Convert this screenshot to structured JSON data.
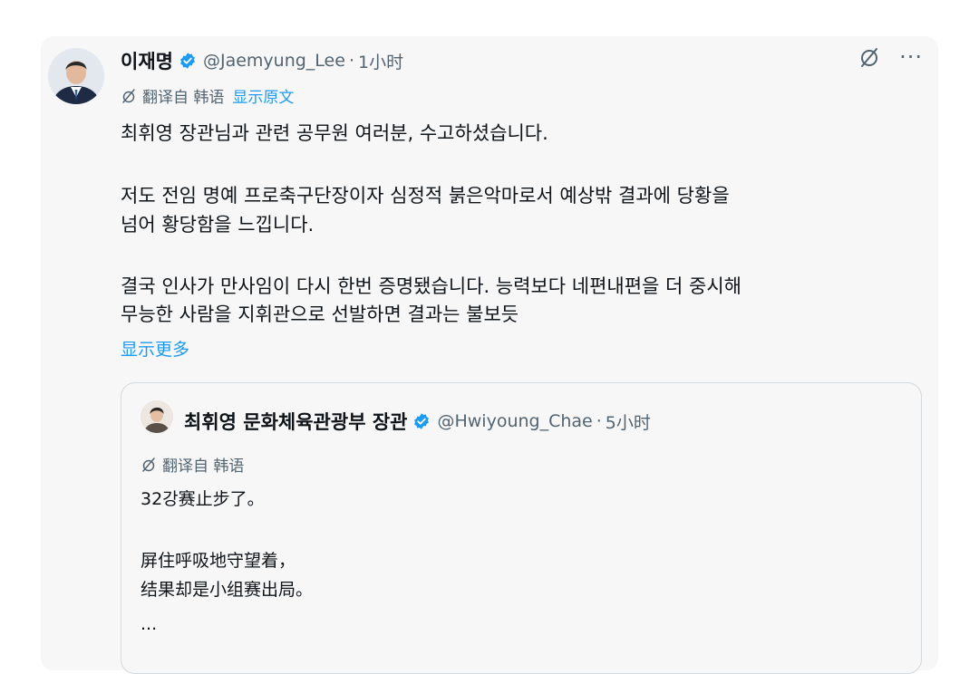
{
  "tweet": {
    "author_name": "이재명",
    "handle": "@Jaemyung_Lee",
    "separator": "·",
    "time": "1小时",
    "translated_from": "翻译自 韩语",
    "show_original": "显示原文",
    "paragraphs": [
      [
        "최휘영 장관님과 관련 공무원 여러분, 수고하셨습니다."
      ],
      [
        "저도 전임 명예 프로축구단장이자 심정적 붉은악마로서 예상밖 결과에 당황을",
        "넘어 황당함을 느낍니다."
      ],
      [
        "결국 인사가 만사임이 다시 한번 증명됐습니다. 능력보다 네편내편을 더 중시해",
        "무능한 사람을 지휘관으로 선발하면 결과는 불보듯"
      ]
    ],
    "show_more": "显示更多",
    "more_glyph": "···"
  },
  "quoted": {
    "author_name": "최휘영 문화체육관광부 장관",
    "handle": "@Hwiyoung_Chae",
    "separator": "·",
    "time": "5小时",
    "translated_from": "翻译自 韩语",
    "lines": [
      "32강赛止步了。",
      "",
      "屏住呼吸地守望着，",
      "结果却是小组赛出局。",
      "..."
    ]
  },
  "colors": {
    "verified": "#1d9bf0",
    "link": "#1d9bf0",
    "muted": "#536471",
    "text": "#0f1419",
    "card": "#f7f7f7"
  },
  "icons": [
    "verified-badge-icon",
    "translate-icon",
    "more-icon"
  ]
}
